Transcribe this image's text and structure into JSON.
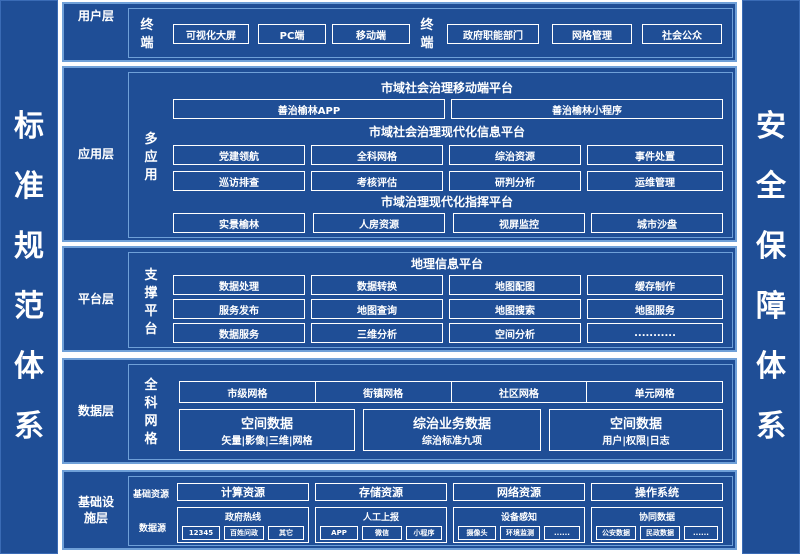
{
  "left_side": [
    "标",
    "准",
    "规",
    "范",
    "体",
    "系"
  ],
  "right_side": [
    "安",
    "全",
    "保",
    "障",
    "体",
    "系"
  ],
  "user_layer": {
    "label": "用户层",
    "terminal_a": "终端",
    "terminal_b": "终端",
    "items_a": [
      "可视化大屏",
      "PC端",
      "移动端"
    ],
    "items_b": [
      "政府职能部门",
      "网格管理",
      "社会公众"
    ]
  },
  "app_layer": {
    "label": "应用层",
    "vlabel": "多应用",
    "mobile_title": "市域社会治理移动端平台",
    "mobile_items": [
      "善治榆林APP",
      "善治榆林小程序"
    ],
    "info_title": "市域社会治理现代化信息平台",
    "info_row1": [
      "党建领航",
      "全科网格",
      "综治资源",
      "事件处置"
    ],
    "info_row2": [
      "巡访排查",
      "考核评估",
      "研判分析",
      "运维管理"
    ],
    "command_title": "市域治理现代化指挥平台",
    "command_items": [
      "实景榆林",
      "人房资源",
      "视屏监控",
      "城市沙盘"
    ]
  },
  "platform_layer": {
    "label": "平台层",
    "vlabel": "支撑平台",
    "title": "地理信息平台",
    "row1": [
      "数据处理",
      "数据转换",
      "地图配图",
      "缓存制作"
    ],
    "row2": [
      "服务发布",
      "地图查询",
      "地图搜索",
      "地图服务"
    ],
    "row3": [
      "数据服务",
      "三维分析",
      "空间分析",
      "..........."
    ]
  },
  "data_layer": {
    "label": "数据层",
    "vlabel": "全科网格",
    "grids": [
      "市级网格",
      "街镇网格",
      "社区网格",
      "单元网格"
    ],
    "big": [
      {
        "title": "空间数据",
        "sub": "矢量|影像|三维|网格"
      },
      {
        "title": "综治业务数据",
        "sub": "综治标准九项"
      },
      {
        "title": "空间数据",
        "sub": "用户|权限|日志"
      }
    ]
  },
  "infra_layer": {
    "label": "基础设施层",
    "res_label": "基础资源",
    "resources": [
      "计算资源",
      "存储资源",
      "网络资源",
      "操作系统"
    ],
    "src_label": "数据源",
    "sources": [
      {
        "title": "政府热线",
        "items": [
          "12345",
          "百姓问政",
          "其它"
        ]
      },
      {
        "title": "人工上报",
        "items": [
          "APP",
          "微信",
          "小程序"
        ]
      },
      {
        "title": "设备感知",
        "items": [
          "摄像头",
          "环境监测",
          "......"
        ]
      },
      {
        "title": "协同数据",
        "items": [
          "公安数据",
          "民政数据",
          "......"
        ]
      }
    ]
  }
}
